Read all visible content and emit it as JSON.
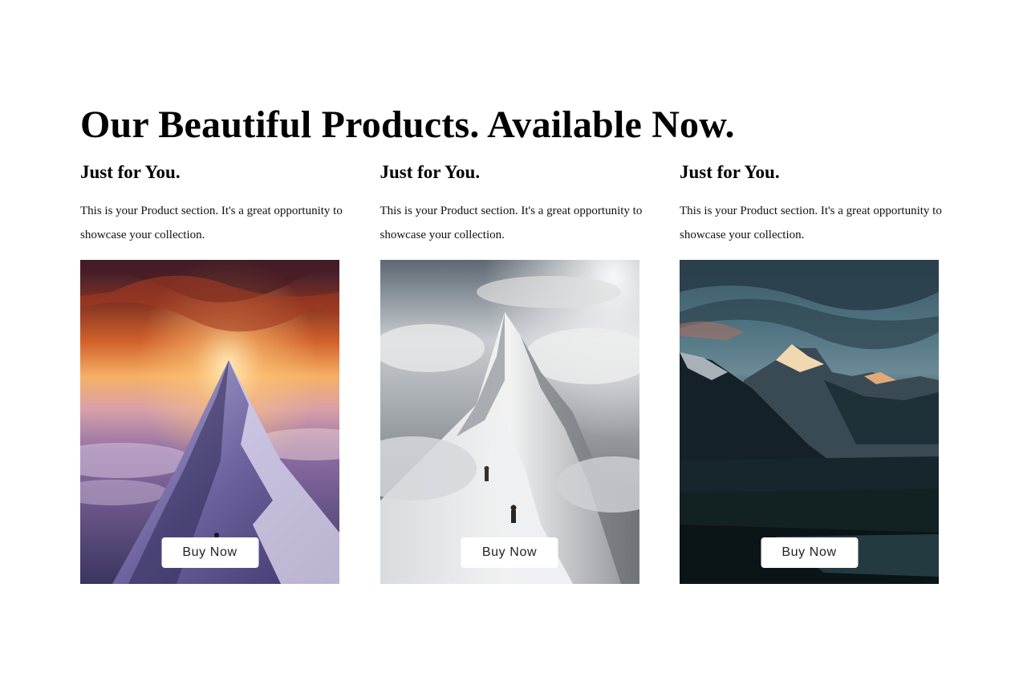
{
  "section": {
    "headline": "Our Beautiful Products. Available Now."
  },
  "products": [
    {
      "title": "Just for You.",
      "description": "This is your Product section. It's a great opportunity to showcase your collection.",
      "button_label": "Buy Now",
      "image": "sunset-mountain-peak-image"
    },
    {
      "title": "Just for You.",
      "description": "This is your Product section. It's a great opportunity to showcase your collection.",
      "button_label": "Buy Now",
      "image": "snowy-ridge-climbers-image"
    },
    {
      "title": "Just for You.",
      "description": "This is your Product section. It's a great opportunity to showcase your collection.",
      "button_label": "Buy Now",
      "image": "alpine-valley-dusk-image"
    }
  ]
}
